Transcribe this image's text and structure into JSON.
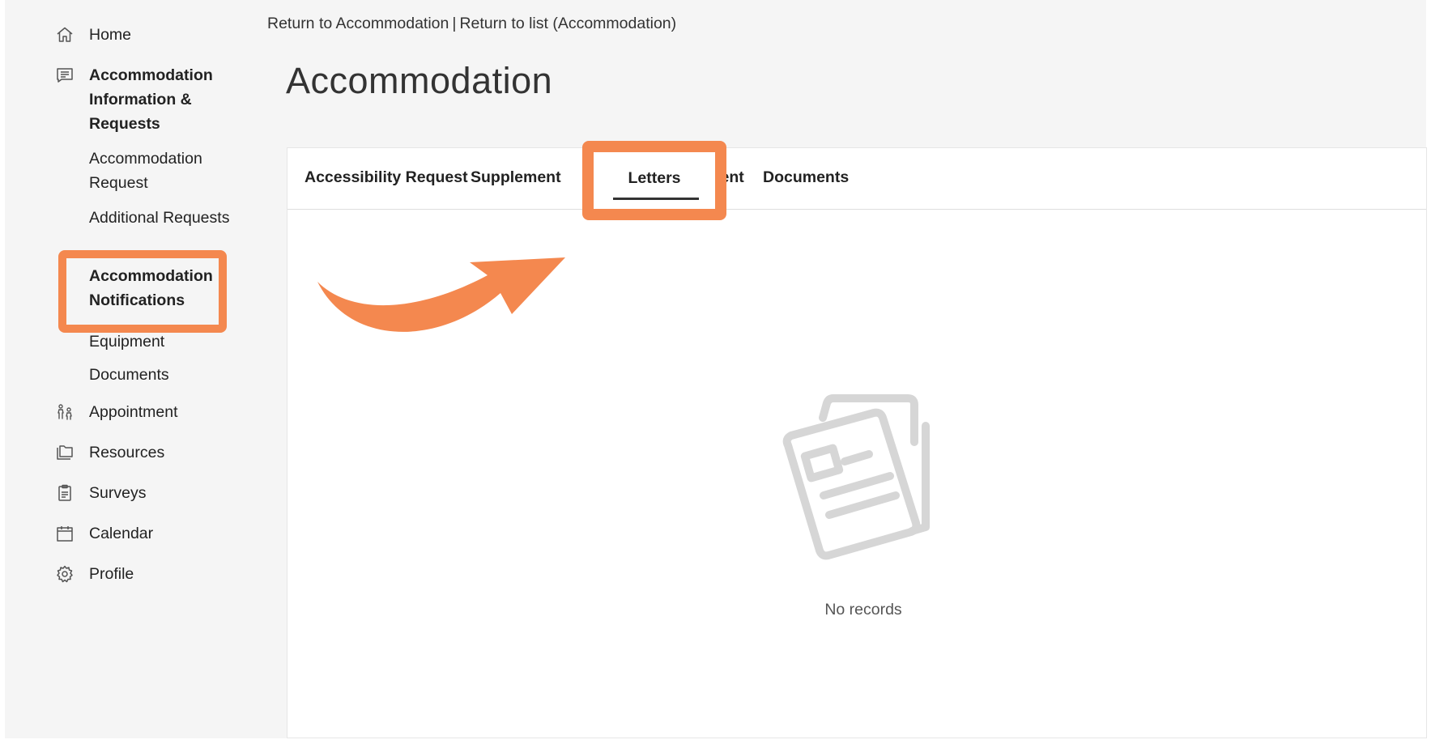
{
  "sidebar": {
    "home": "Home",
    "accommodation_info": "Accommodation Information & Requests",
    "sub_items": [
      "Accommodation Request",
      "Additional Requests",
      "Accommodation Notifications",
      "Equipment",
      "Documents"
    ],
    "appointment": "Appointment",
    "resources": "Resources",
    "surveys": "Surveys",
    "calendar": "Calendar",
    "profile": "Profile"
  },
  "breadcrumb": {
    "return_accommodation": "Return to Accommodation",
    "separator": "|",
    "return_list": "Return to list (Accommodation)"
  },
  "page": {
    "title": "Accommodation"
  },
  "tabs": [
    "Accessibility Request",
    "Supplement",
    "Letters",
    "quipment",
    "Documents"
  ],
  "empty_state": {
    "message": "No records"
  },
  "colors": {
    "highlight": "#f4884f",
    "page_bg": "#f5f5f5",
    "empty_icon": "#d6d6d6"
  }
}
